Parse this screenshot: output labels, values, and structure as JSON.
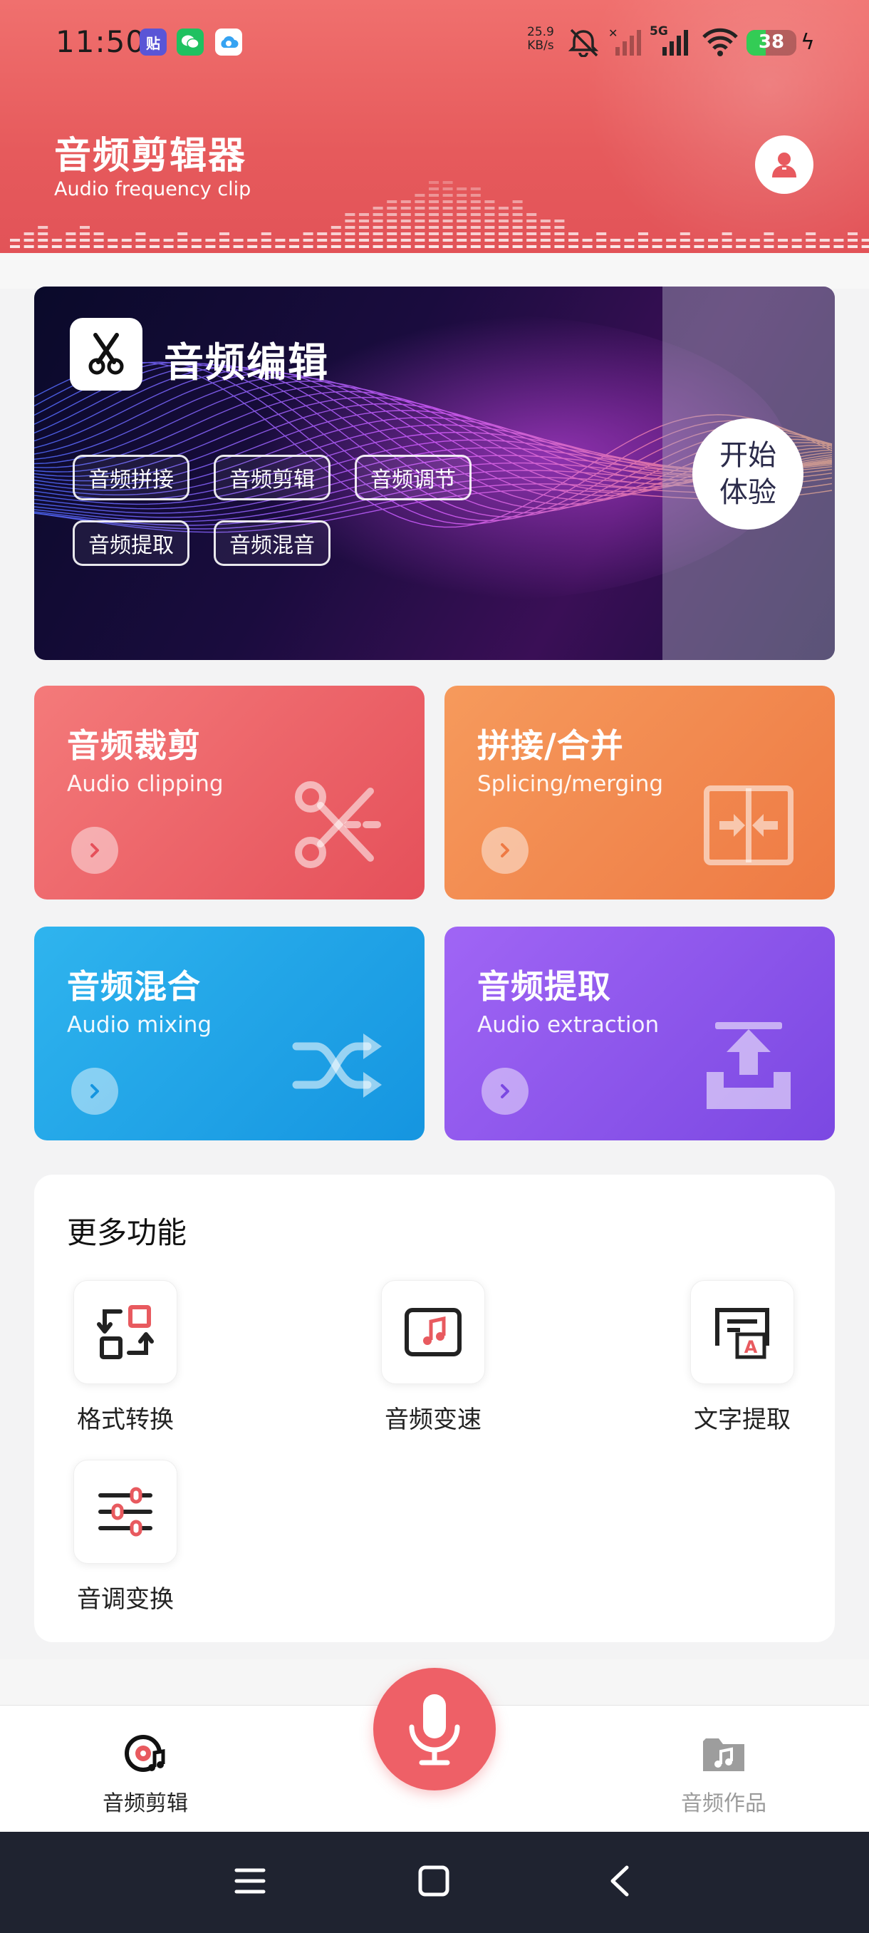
{
  "status_bar": {
    "time": "11:50",
    "notif_icons": [
      "tieba-icon",
      "wechat-icon",
      "cloud-icon"
    ],
    "net_speed_value": "25.9",
    "net_speed_unit": "KB/s",
    "network": "5G",
    "battery": "38",
    "battery_level": 0.38
  },
  "header": {
    "title": "音频剪辑器",
    "subtitle": "Audio frequency clip"
  },
  "banner": {
    "title": "音频编辑",
    "chips": [
      "音频拼接",
      "音频剪辑",
      "音频调节",
      "音频提取",
      "音频混音"
    ],
    "start_line1": "开始",
    "start_line2": "体验"
  },
  "cards": [
    {
      "title": "音频裁剪",
      "subtitle": "Audio clipping",
      "icon": "scissors-icon",
      "color": "#e5505a"
    },
    {
      "title": "拼接/合并",
      "subtitle": "Splicing/merging",
      "icon": "merge-icon",
      "color": "#ee7a44"
    },
    {
      "title": "音频混合",
      "subtitle": "Audio mixing",
      "icon": "shuffle-icon",
      "color": "#1595e0"
    },
    {
      "title": "音频提取",
      "subtitle": "Audio extraction",
      "icon": "extract-icon",
      "color": "#7b48e2"
    }
  ],
  "more": {
    "title": "更多功能",
    "tools": [
      {
        "label": "格式转换",
        "icon": "format-convert-icon"
      },
      {
        "label": "音频变速",
        "icon": "music-note-icon"
      },
      {
        "label": "文字提取",
        "icon": "text-extract-icon"
      },
      {
        "label": "音调变换",
        "icon": "sliders-icon"
      }
    ]
  },
  "bottom_nav": {
    "left_label": "音频剪辑",
    "right_label": "音频作品",
    "active": "音频剪辑",
    "accent": "#ee6067"
  }
}
